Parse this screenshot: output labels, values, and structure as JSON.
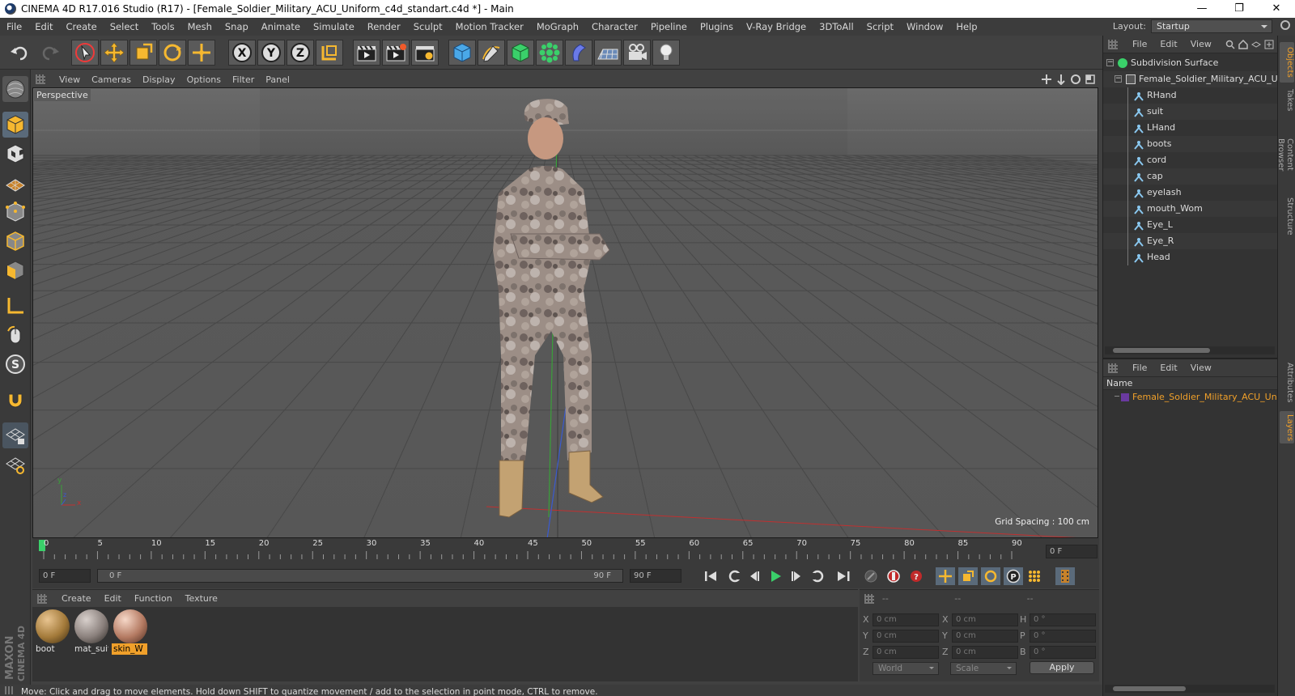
{
  "window": {
    "title": "CINEMA 4D R17.016 Studio (R17) - [Female_Soldier_Military_ACU_Uniform_c4d_standart.c4d *] - Main",
    "minimize": "—",
    "maximize": "❐",
    "close": "✕"
  },
  "menu": [
    "File",
    "Edit",
    "Create",
    "Select",
    "Tools",
    "Mesh",
    "Snap",
    "Animate",
    "Simulate",
    "Render",
    "Sculpt",
    "Motion Tracker",
    "MoGraph",
    "Character",
    "Pipeline",
    "Plugins",
    "V-Ray Bridge",
    "3DToAll",
    "Script",
    "Window",
    "Help"
  ],
  "layout": {
    "label": "Layout:",
    "value": "Startup"
  },
  "viewport": {
    "menu": [
      "View",
      "Cameras",
      "Display",
      "Options",
      "Filter",
      "Panel"
    ],
    "label": "Perspective",
    "grid_spacing": "Grid Spacing : 100 cm",
    "axis_x": "x",
    "axis_y": "y",
    "axis_z": "z"
  },
  "timeline": {
    "ticks": [
      "0",
      "5",
      "10",
      "15",
      "20",
      "25",
      "30",
      "35",
      "40",
      "45",
      "50",
      "55",
      "60",
      "65",
      "70",
      "75",
      "80",
      "85",
      "90"
    ],
    "current_frame_field": "0 F",
    "start_field": "0 F",
    "range_start": "0 F",
    "range_end": "90 F",
    "end_field": "90 F",
    "end_frame": "90 F"
  },
  "materials": {
    "menu": [
      "Create",
      "Edit",
      "Function",
      "Texture"
    ],
    "items": [
      {
        "label": "boot",
        "selected": false
      },
      {
        "label": "mat_suit",
        "selected": false
      },
      {
        "label": "skin_W",
        "selected": true
      }
    ]
  },
  "coordinates": {
    "headers": [
      "--",
      "--",
      "--"
    ],
    "rows": [
      {
        "l1": "X",
        "v1": "0 cm",
        "l2": "X",
        "v2": "0 cm",
        "l3": "H",
        "v3": "0 °"
      },
      {
        "l1": "Y",
        "v1": "0 cm",
        "l2": "Y",
        "v2": "0 cm",
        "l3": "P",
        "v3": "0 °"
      },
      {
        "l1": "Z",
        "v1": "0 cm",
        "l2": "Z",
        "v2": "0 cm",
        "l3": "B",
        "v3": "0 °"
      }
    ],
    "mode": "World",
    "scale": "Scale",
    "apply": "Apply"
  },
  "objects": {
    "menu": [
      "File",
      "Edit",
      "View"
    ],
    "root": "Subdivision Surface",
    "group": "Female_Soldier_Military_ACU_Un",
    "children": [
      "RHand",
      "suit",
      "LHand",
      "boots",
      "cord",
      "cap",
      "eyelash",
      "mouth_Wom",
      "Eye_L",
      "Eye_R",
      "Head"
    ]
  },
  "layers": {
    "menu": [
      "File",
      "Edit",
      "View"
    ],
    "header": "Name",
    "item": "Female_Soldier_Military_ACU_Unif"
  },
  "side_tabs": [
    "Objects",
    "Takes",
    "Content Browser",
    "Structure",
    "Attributes",
    "Layers"
  ],
  "status": "Move: Click and drag to move elements. Hold down SHIFT to quantize movement / add to the selection in point mode, CTRL to remove.",
  "brand": {
    "line1": "MAXON",
    "line2": "CINEMA 4D"
  },
  "colors": {
    "accent": "#f0a02a",
    "background": "#414141",
    "viewport_bg": "#5a5a5a"
  }
}
